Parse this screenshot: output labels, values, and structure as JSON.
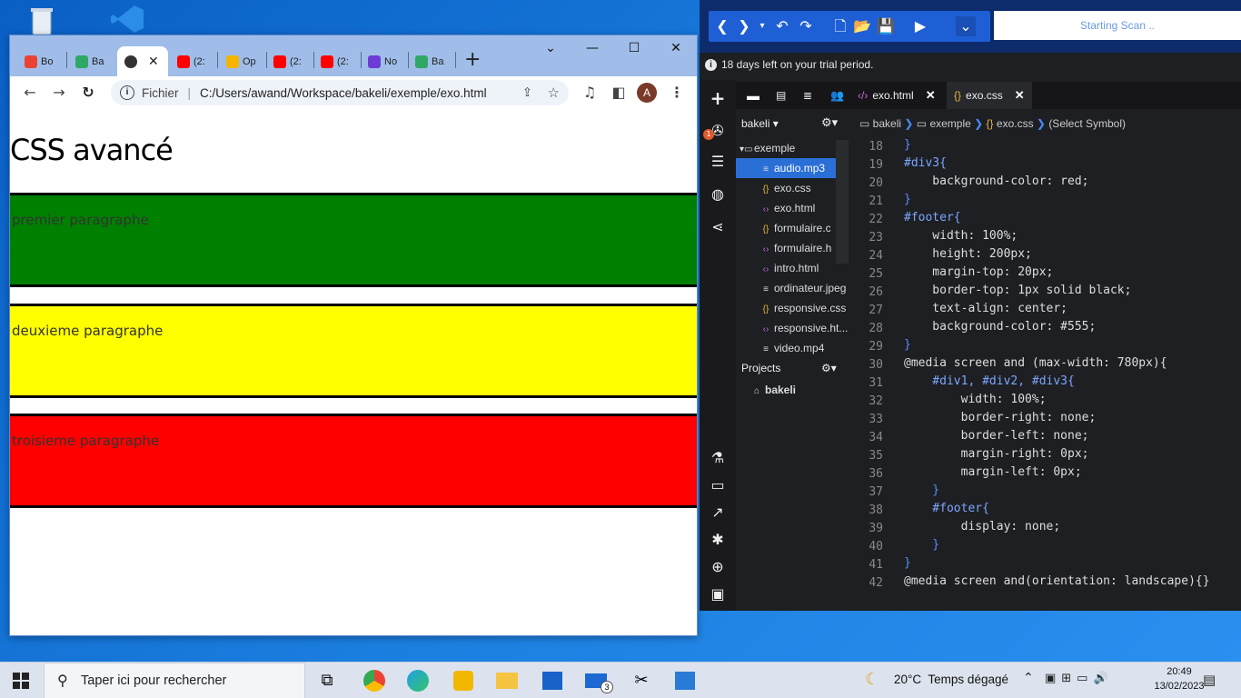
{
  "chrome": {
    "tabs": [
      {
        "label": "Bo",
        "color": "#ea4335"
      },
      {
        "label": "Ba",
        "color": "#2fa865"
      },
      {
        "label": "",
        "color": "#333333"
      },
      {
        "label": "(2:",
        "color": "#ff0000"
      },
      {
        "label": "Op",
        "color": "#f4b400"
      },
      {
        "label": "(2:",
        "color": "#ff0000"
      },
      {
        "label": "(2:",
        "color": "#ff0000"
      },
      {
        "label": "No",
        "color": "#6c3bd6"
      },
      {
        "label": "Ba",
        "color": "#2fa865"
      }
    ],
    "new_tab": "+",
    "address_prefix": "Fichier",
    "url": "C:/Users/awand/Workspace/bakeli/exemple/exo.html",
    "avatar_letter": "A"
  },
  "page": {
    "title": "CSS avancé",
    "paragraphs": [
      {
        "text": "premier paragraphe",
        "color": "#008000"
      },
      {
        "text": "deuxieme paragraphe",
        "color": "#ffff00"
      },
      {
        "text": "troisieme paragraphe",
        "color": "#ff0000"
      }
    ]
  },
  "editor": {
    "scan_status": "Starting Scan ..",
    "trial_notice": "18 days left on your trial period.",
    "notification_count": "1",
    "tabs": [
      {
        "label": "exo.html",
        "active": false
      },
      {
        "label": "exo.css",
        "active": true
      }
    ],
    "project_name": "bakeli",
    "breadcrumb": [
      "bakeli",
      "exemple",
      "exo.css",
      "(Select Symbol)"
    ],
    "tree": [
      {
        "label": "exemple",
        "type": "folder"
      },
      {
        "label": "audio.mp3",
        "type": "file",
        "selected": true
      },
      {
        "label": "exo.css",
        "type": "css"
      },
      {
        "label": "exo.html",
        "type": "html"
      },
      {
        "label": "formulaire.c",
        "type": "css"
      },
      {
        "label": "formulaire.h",
        "type": "html"
      },
      {
        "label": "intro.html",
        "type": "html"
      },
      {
        "label": "ordinateur.jpeg",
        "type": "file"
      },
      {
        "label": "responsive.css",
        "type": "css"
      },
      {
        "label": "responsive.ht...",
        "type": "html"
      },
      {
        "label": "video.mp4",
        "type": "file"
      }
    ],
    "projects_label": "Projects",
    "projects": [
      "bakeli"
    ],
    "code_lines": [
      {
        "n": "18",
        "t": "}"
      },
      {
        "n": "19",
        "t": "#div3{"
      },
      {
        "n": "20",
        "t": "    background-color: red;"
      },
      {
        "n": "21",
        "t": "}"
      },
      {
        "n": "22",
        "t": "#footer{"
      },
      {
        "n": "23",
        "t": "    width: 100%;"
      },
      {
        "n": "24",
        "t": "    height: 200px;"
      },
      {
        "n": "25",
        "t": "    margin-top: 20px;"
      },
      {
        "n": "26",
        "t": "    border-top: 1px solid black;"
      },
      {
        "n": "27",
        "t": "    text-align: center;"
      },
      {
        "n": "28",
        "t": "    background-color: #555;"
      },
      {
        "n": "29",
        "t": "}"
      },
      {
        "n": "30",
        "t": "@media screen and (max-width: 780px){"
      },
      {
        "n": "31",
        "t": "    #div1, #div2, #div3{"
      },
      {
        "n": "32",
        "t": "        width: 100%;"
      },
      {
        "n": "33",
        "t": "        border-right: none;"
      },
      {
        "n": "34",
        "t": "        border-left: none;"
      },
      {
        "n": "35",
        "t": "        margin-right: 0px;"
      },
      {
        "n": "36",
        "t": "        margin-left: 0px;"
      },
      {
        "n": "37",
        "t": "    }"
      },
      {
        "n": "38",
        "t": "    #footer{"
      },
      {
        "n": "39",
        "t": "        display: none;"
      },
      {
        "n": "40",
        "t": "    }"
      },
      {
        "n": "41",
        "t": "}"
      },
      {
        "n": "42",
        "t": "@media screen and(orientation: landscape){}"
      }
    ]
  },
  "taskbar": {
    "search_placeholder": "Taper ici pour rechercher",
    "weather": "20°C  Temps dégagé",
    "time": "20:49",
    "date": "13/02/2023",
    "mail_badge": "3"
  }
}
